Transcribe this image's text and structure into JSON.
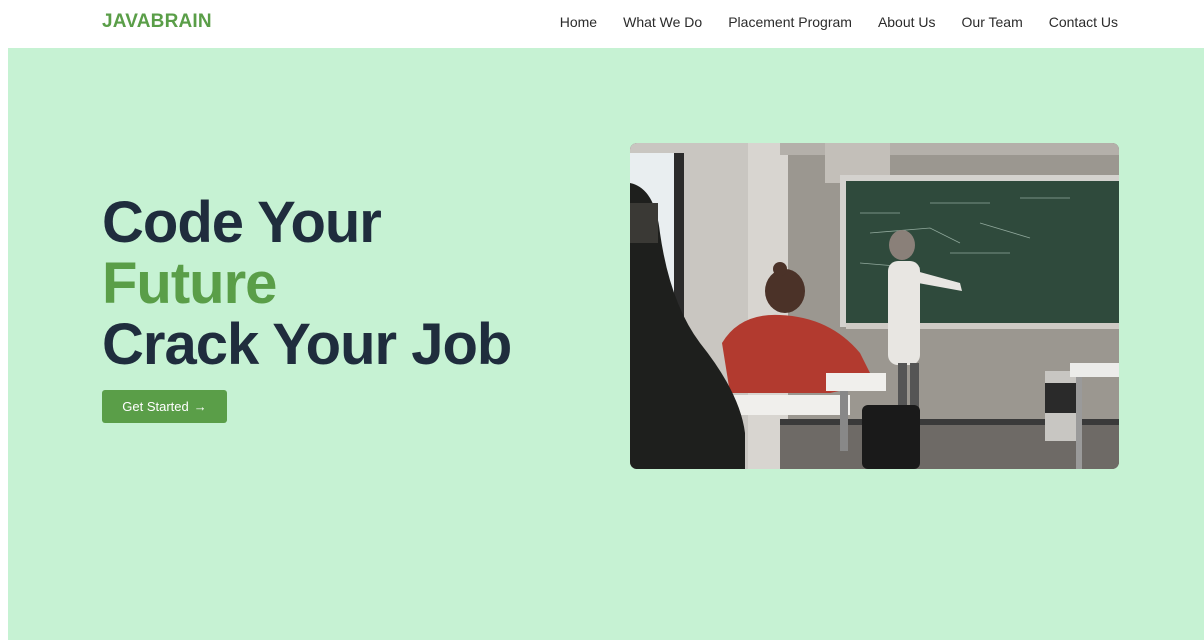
{
  "brand": {
    "name": "JAVABRAIN"
  },
  "nav": {
    "items": [
      {
        "label": "Home"
      },
      {
        "label": "What We Do"
      },
      {
        "label": "Placement Program"
      },
      {
        "label": "About Us"
      },
      {
        "label": "Our Team"
      },
      {
        "label": "Contact Us"
      }
    ]
  },
  "hero": {
    "line1": "Code Your",
    "line2": "Future",
    "line3": "Crack Your Job",
    "cta_label": "Get Started",
    "cta_icon": "→",
    "image": {
      "subject": "classroom-photo"
    }
  },
  "colors": {
    "brand_green": "#5a9e48",
    "heading_navy": "#1f2d3d",
    "hero_bg": "#c6f2d3"
  }
}
